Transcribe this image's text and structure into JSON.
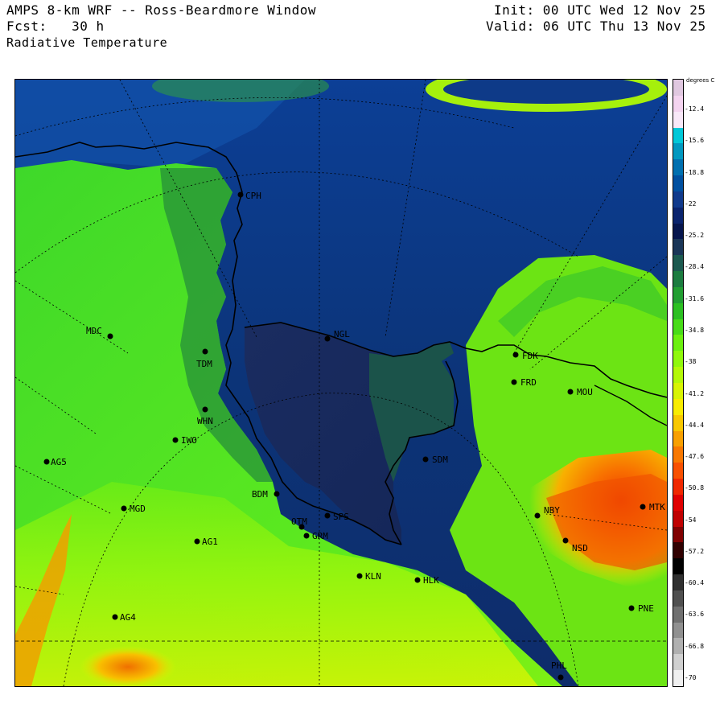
{
  "header": {
    "title": "AMPS 8-km WRF -- Ross-Beardmore Window",
    "forecast": "Fcst:   30 h",
    "field": "Radiative Temperature",
    "init": "Init: 00 UTC Wed 12 Nov 25",
    "valid": "Valid: 06 UTC Thu 13 Nov 25"
  },
  "colorbar": {
    "units": "degrees C",
    "ticks": [
      "-12.4",
      "-15.6",
      "-18.8",
      "-22",
      "-25.2",
      "-28.4",
      "-31.6",
      "-34.8",
      "-38",
      "-41.2",
      "-44.4",
      "-47.6",
      "-50.8",
      "-54",
      "-57.2",
      "-60.4",
      "-63.6",
      "-66.8",
      "-70"
    ],
    "colors": [
      "#e0c8e0",
      "#f4d4f0",
      "#f8e8f8",
      "#00c8d8",
      "#0098c0",
      "#0070b0",
      "#0050a0",
      "#103a8c",
      "#0a246e",
      "#06164e",
      "#1a3658",
      "#1c5a50",
      "#1c7c40",
      "#229e32",
      "#2cc022",
      "#48dc18",
      "#6cf010",
      "#90f80c",
      "#b4f808",
      "#d8f404",
      "#f8ec00",
      "#f8c800",
      "#f8a000",
      "#f87800",
      "#f85000",
      "#f02800",
      "#e00000",
      "#c00000",
      "#800000",
      "#300000",
      "#000000",
      "#303030",
      "#505050",
      "#707070",
      "#909090",
      "#b0b0b0",
      "#d0d0d0",
      "#f0f0f0"
    ]
  },
  "stations": [
    {
      "code": "CPH"
    },
    {
      "code": "NGL"
    },
    {
      "code": "FDK"
    },
    {
      "code": "FRD"
    },
    {
      "code": "MOU"
    },
    {
      "code": "MDC"
    },
    {
      "code": "TDM"
    },
    {
      "code": "WHN"
    },
    {
      "code": "IWO"
    },
    {
      "code": "AG5"
    },
    {
      "code": "SDM"
    },
    {
      "code": "BDM"
    },
    {
      "code": "MGD"
    },
    {
      "code": "NBY"
    },
    {
      "code": "MTK"
    },
    {
      "code": "OTM"
    },
    {
      "code": "SPS"
    },
    {
      "code": "GRM"
    },
    {
      "code": "NSD"
    },
    {
      "code": "AG1"
    },
    {
      "code": "KLN"
    },
    {
      "code": "HLK"
    },
    {
      "code": "AG4"
    },
    {
      "code": "PNE"
    },
    {
      "code": "PHL"
    }
  ]
}
